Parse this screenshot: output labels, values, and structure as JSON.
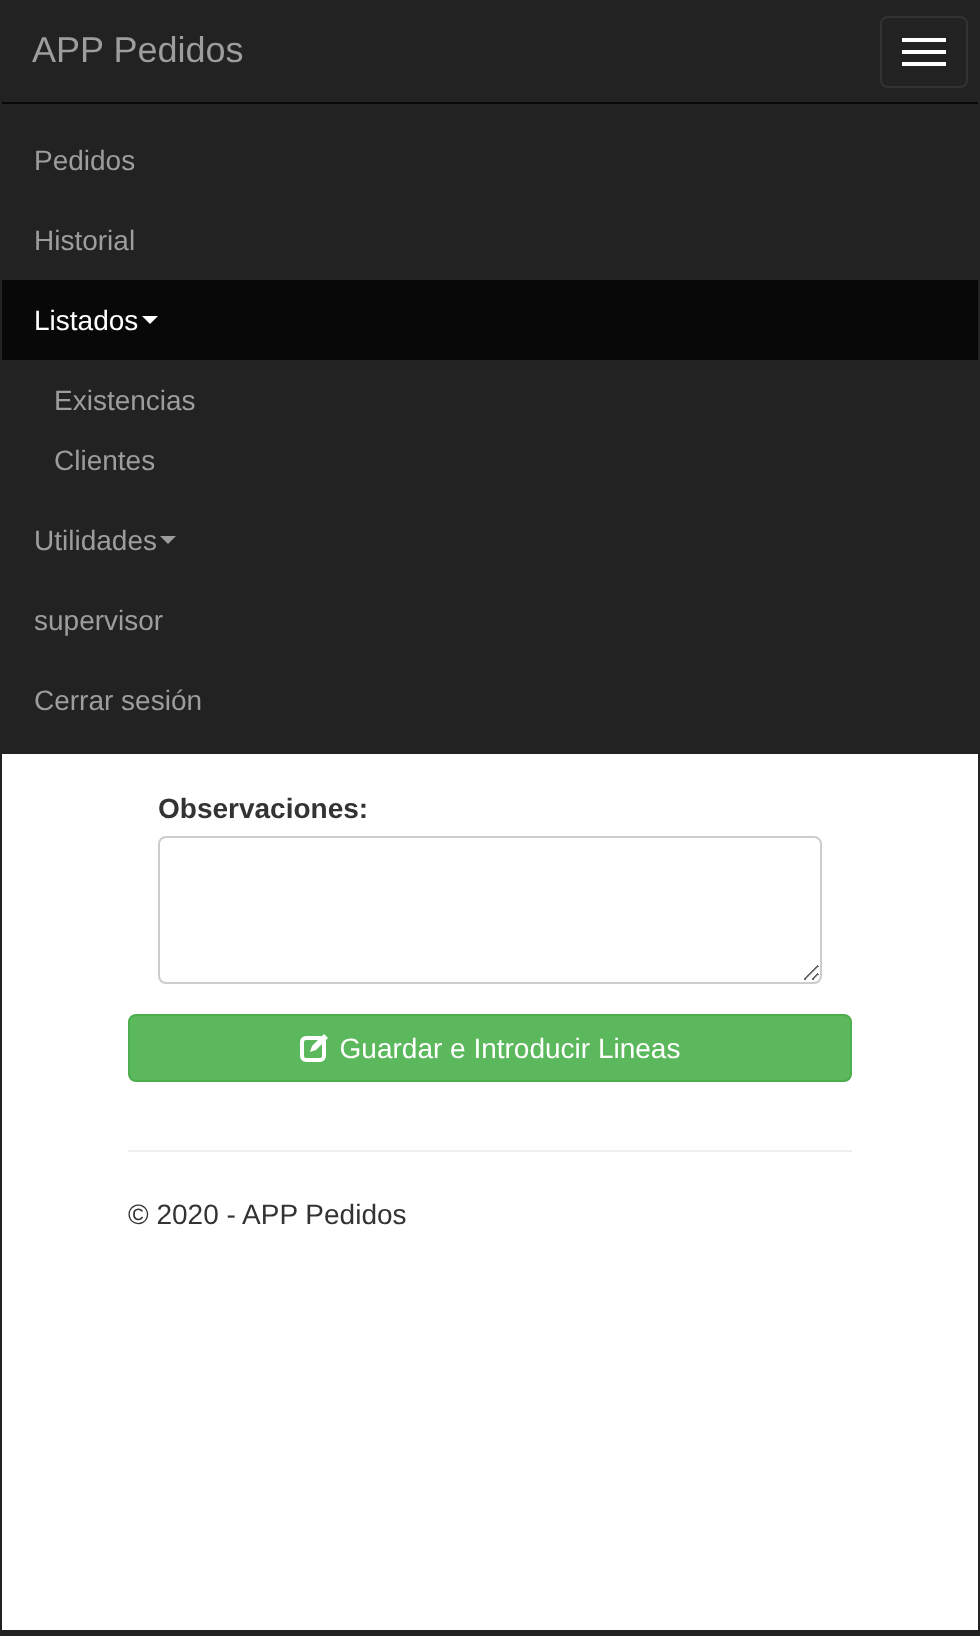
{
  "navbar": {
    "brand": "APP Pedidos"
  },
  "menu": [
    {
      "kind": "link",
      "label": "Pedidos"
    },
    {
      "kind": "link",
      "label": "Historial"
    },
    {
      "kind": "dropdown",
      "label": "Listados",
      "expanded": true,
      "children": [
        {
          "label": "Existencias"
        },
        {
          "label": "Clientes"
        }
      ]
    },
    {
      "kind": "dropdown",
      "label": "Utilidades",
      "expanded": false
    },
    {
      "kind": "link",
      "label": "supervisor"
    },
    {
      "kind": "link",
      "label": "Cerrar sesión"
    }
  ],
  "form": {
    "label": "Observaciones:",
    "button": "Guardar e Introducir Lineas"
  },
  "footer": "© 2020 - APP Pedidos"
}
